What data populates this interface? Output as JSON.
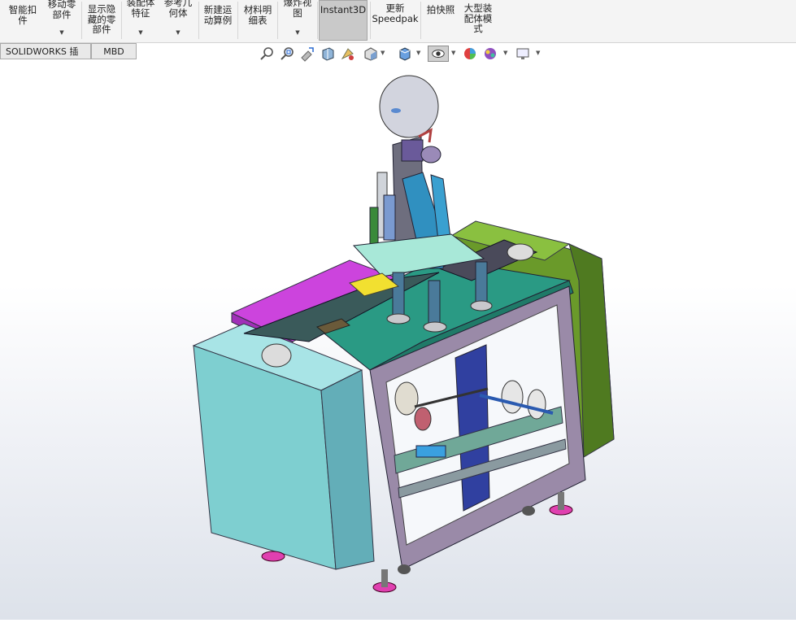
{
  "ribbon": {
    "items": [
      {
        "label": "智能扣\n件",
        "has_menu": false
      },
      {
        "label": "移动零\n部件",
        "has_menu": true
      },
      {
        "label": "显示隐\n藏的零\n部件",
        "has_menu": false
      },
      {
        "label": "装配体\n特征",
        "has_menu": true
      },
      {
        "label": "参考几\n何体",
        "has_menu": true
      },
      {
        "label": "新建运\n动算例",
        "has_menu": false
      },
      {
        "label": "材料明\n细表",
        "has_menu": false
      },
      {
        "label": "爆炸视\n图",
        "has_menu": true
      },
      {
        "label": "Instant3D",
        "has_menu": false,
        "active": true
      },
      {
        "label": "更新\nSpeedpak",
        "has_menu": false
      },
      {
        "label": "拍快照",
        "has_menu": false
      },
      {
        "label": "大型装\n配体模\n式",
        "has_menu": false
      }
    ]
  },
  "tabs": [
    {
      "label": "SOLIDWORKS 插件"
    },
    {
      "label": "MBD"
    }
  ],
  "view_toolbar": {
    "icons": [
      "zoom-to-fit-icon",
      "zoom-to-area-icon",
      "previous-view-icon",
      "section-view-icon",
      "dynamic-annotation-icon",
      "view-orientation-icon",
      "display-style-icon",
      "hide-show-items-icon",
      "edit-appearance-icon",
      "apply-scene-icon",
      "view-settings-icon"
    ]
  },
  "colors": {
    "cabinet_cyan": "#7ecfd0",
    "top_plate_teal": "#2a9a84",
    "magenta": "#cc44dd",
    "olive_green": "#6a9a2a",
    "frame_purple": "#8a7a9a",
    "feet_magenta": "#e040b0"
  }
}
